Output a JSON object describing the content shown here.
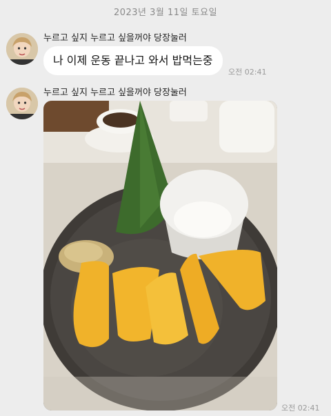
{
  "date_separator": "2023년 3월 11일 토요일",
  "messages": [
    {
      "sender": "누르고 싶지 누르고 싶을꺼야 당장눌러",
      "text": "나 이제 운동 끝나고 와서 밥먹는중",
      "time": "오전 02:41",
      "avatar_icon": "profile-avatar"
    },
    {
      "sender": "누르고 싶지 누르고 싶을꺼야 당장눌러",
      "type": "photo",
      "photo_description": "mango-sticky-rice-dessert-photo",
      "time": "오전 02:41",
      "avatar_icon": "profile-avatar"
    }
  ],
  "colors": {
    "background": "#ededed",
    "bubble": "#ffffff",
    "time_text": "#999999"
  }
}
